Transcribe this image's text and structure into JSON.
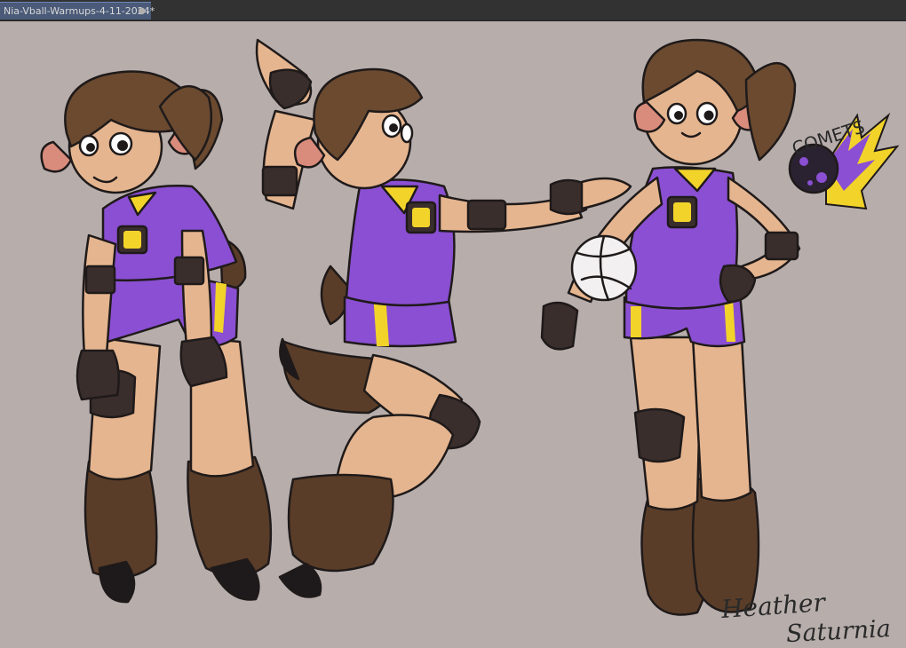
{
  "document": {
    "tab_title": "Nia-Vball-Warmups-4-11-2024*",
    "tab_close_symbol": "●"
  },
  "artwork": {
    "team_logo_text": "COMETS",
    "signature_line1": "Heather",
    "signature_line2": "Saturnia",
    "colors": {
      "background": "#b7aeac",
      "jersey_purple": "#8a4fd2",
      "jersey_yellow": "#f2d32a",
      "skin": "#e5b58f",
      "fur_brown": "#5a3d28",
      "outline": "#1f1a1a"
    }
  }
}
